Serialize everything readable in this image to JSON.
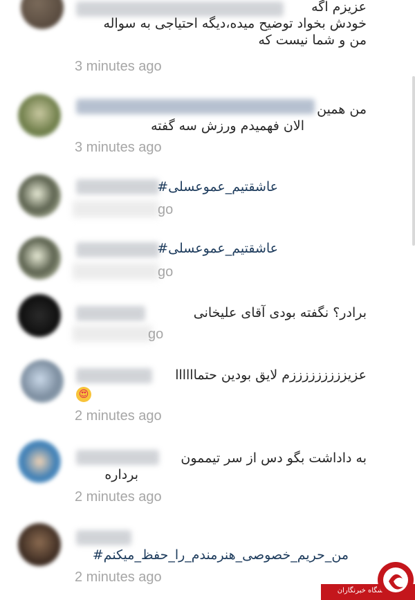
{
  "comments": [
    {
      "lines": [
        "عزیزم اگه",
        "خودش بخواد توضیح میده،دیگه احتیاجی به سواله",
        "من و شما نیست که"
      ],
      "time": "3 minutes ago"
    },
    {
      "lines": [
        "من همین",
        "الان فهمیدم ورزش سه گفته"
      ],
      "time": "3 minutes ago"
    },
    {
      "lines": [
        "عاشقتیم_عموعسلی#"
      ],
      "time": "go"
    },
    {
      "lines": [
        "عاشقتیم_عموعسلی#"
      ],
      "time": "go"
    },
    {
      "lines": [
        "برادر؟ نگفته بودی آقای علیخانی"
      ],
      "time": "go"
    },
    {
      "lines": [
        "عزیزززززززززم لایق بودین حتماااااا"
      ],
      "emoji": "😍",
      "time": "2 minutes ago"
    },
    {
      "lines": [
        "به داداشت بگو دس از سر تیممون",
        "برداره"
      ],
      "time": "2 minutes ago"
    },
    {
      "lines": [
        "من_حریم_خصوصی_هنرمندم_را_حفظ_میکنم#"
      ],
      "time": "2 minutes ago"
    }
  ],
  "logo": {
    "text": "باشگاه خبرنگاران",
    "colors": {
      "red": "#c4161c",
      "white": "#ffffff"
    }
  }
}
